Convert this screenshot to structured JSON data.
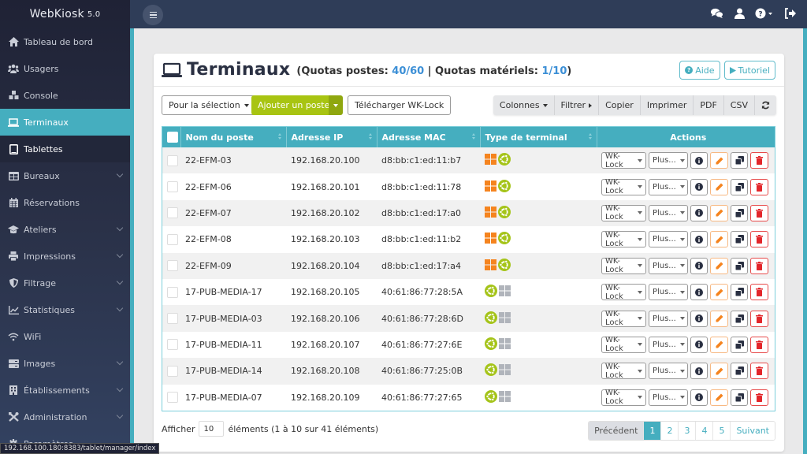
{
  "app": {
    "brand": "WebKiosk",
    "version": "5.0"
  },
  "sidebar": {
    "items": [
      {
        "label": "Tableau de bord",
        "icon": "home-icon",
        "expandable": false,
        "state": ""
      },
      {
        "label": "Usagers",
        "icon": "users-icon",
        "expandable": false,
        "state": ""
      },
      {
        "label": "Console",
        "icon": "cubes-icon",
        "expandable": false,
        "state": ""
      },
      {
        "label": "Terminaux",
        "icon": "laptop-icon",
        "expandable": false,
        "state": "active"
      },
      {
        "label": "Tablettes",
        "icon": "tablet-icon",
        "expandable": false,
        "state": "sub-active"
      },
      {
        "label": "Bureaux",
        "icon": "table-icon",
        "expandable": true,
        "state": ""
      },
      {
        "label": "Réservations",
        "icon": "calendar-icon",
        "expandable": false,
        "state": ""
      },
      {
        "label": "Ateliers",
        "icon": "graduation-cap-icon",
        "expandable": true,
        "state": ""
      },
      {
        "label": "Impressions",
        "icon": "printer-icon",
        "expandable": true,
        "state": ""
      },
      {
        "label": "Filtrage",
        "icon": "shield-icon",
        "expandable": true,
        "state": ""
      },
      {
        "label": "Statistiques",
        "icon": "chart-line-icon",
        "expandable": true,
        "state": ""
      },
      {
        "label": "WiFi",
        "icon": "wifi-icon",
        "expandable": false,
        "state": ""
      },
      {
        "label": "Images",
        "icon": "server-icon",
        "expandable": true,
        "state": ""
      },
      {
        "label": "Établissements",
        "icon": "building-icon",
        "expandable": true,
        "state": ""
      },
      {
        "label": "Administration",
        "icon": "tools-icon",
        "expandable": true,
        "state": ""
      },
      {
        "label": "Paramètres",
        "icon": "gear-icon",
        "expandable": false,
        "state": ""
      }
    ]
  },
  "status_bar_url": "192.168.100.180:8383/tablet/manager/index",
  "topbar": {
    "icons": [
      "chat-icon",
      "user-icon",
      "help-icon",
      "logout-icon"
    ]
  },
  "page": {
    "title": "Terminaux",
    "quota_prefix": "(Quotas postes: ",
    "quota_postes": "40/60",
    "quota_sep": " | Quotas matériels: ",
    "quota_materiels": "1/10",
    "quota_suffix": ")",
    "help_button": "Aide",
    "tutorial_button": "Tutoriel"
  },
  "toolbar": {
    "selection_label": "Pour la sélection",
    "add_label": "Ajouter un poste",
    "download_label": "Télécharger WK-Lock",
    "group": {
      "columns": "Colonnes",
      "filter": "Filtrer",
      "copy": "Copier",
      "print": "Imprimer",
      "pdf": "PDF",
      "csv": "CSV"
    }
  },
  "table": {
    "headers": {
      "name": "Nom du poste",
      "ip": "Adresse IP",
      "mac": "Adresse MAC",
      "type": "Type de terminal",
      "actions": "Actions"
    },
    "action_labels": {
      "wklock": "WK-Lock",
      "more": "Plus..."
    },
    "rows": [
      {
        "name": "22-EFM-03",
        "ip": "192.168.20.100",
        "mac": "d8:bb:c1:ed:11:b7",
        "primary_os": "windows"
      },
      {
        "name": "22-EFM-06",
        "ip": "192.168.20.101",
        "mac": "d8:bb:c1:ed:11:78",
        "primary_os": "windows"
      },
      {
        "name": "22-EFM-07",
        "ip": "192.168.20.102",
        "mac": "d8:bb:c1:ed:17:a0",
        "primary_os": "windows"
      },
      {
        "name": "22-EFM-08",
        "ip": "192.168.20.103",
        "mac": "d8:bb:c1:ed:11:b2",
        "primary_os": "windows"
      },
      {
        "name": "22-EFM-09",
        "ip": "192.168.20.104",
        "mac": "d8:bb:c1:ed:17:a4",
        "primary_os": "windows"
      },
      {
        "name": "17-PUB-MEDIA-17",
        "ip": "192.168.20.105",
        "mac": "40:61:86:77:28:5A",
        "primary_os": "ubuntu"
      },
      {
        "name": "17-PUB-MEDIA-03",
        "ip": "192.168.20.106",
        "mac": "40:61:86:77:28:6D",
        "primary_os": "ubuntu"
      },
      {
        "name": "17-PUB-MEDIA-11",
        "ip": "192.168.20.107",
        "mac": "40:61:86:77:27:6E",
        "primary_os": "ubuntu"
      },
      {
        "name": "17-PUB-MEDIA-14",
        "ip": "192.168.20.108",
        "mac": "40:61:86:77:25:0B",
        "primary_os": "ubuntu"
      },
      {
        "name": "17-PUB-MEDIA-07",
        "ip": "192.168.20.109",
        "mac": "40:61:86:77:27:65",
        "primary_os": "ubuntu"
      }
    ]
  },
  "footer": {
    "show_label": "Afficher",
    "page_length": "10",
    "info": "éléments (1 à 10 sur 41 éléments)",
    "pagination": {
      "previous": "Précédent",
      "pages": [
        "1",
        "2",
        "3",
        "4",
        "5"
      ],
      "current": "1",
      "next": "Suivant"
    }
  },
  "colors": {
    "accent": "#45aebf",
    "success": "#a8c412",
    "windows": "#f5841f",
    "ubuntu": "#a5c41a",
    "inactive_os": "#b0b4bb",
    "danger": "#e3262b",
    "warning": "#f5841f",
    "link": "#3c8fd6"
  }
}
